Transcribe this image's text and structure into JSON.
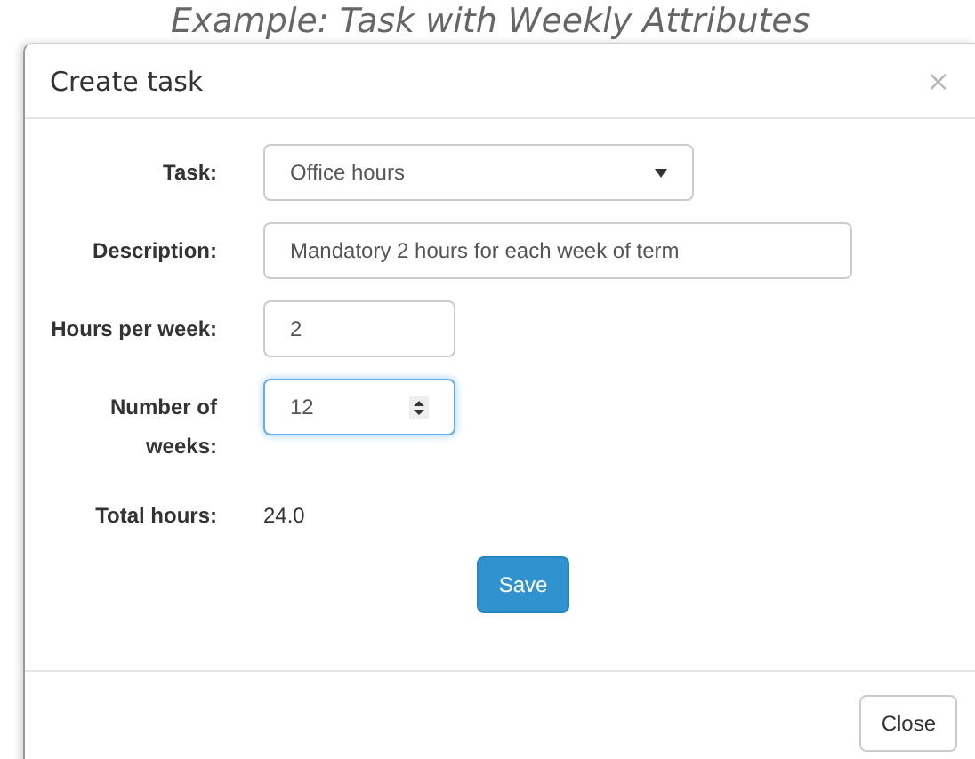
{
  "page_heading": "Example: Task with Weekly Attributes",
  "dialog": {
    "title": "Create task",
    "close_glyph": "×",
    "fields": [
      {
        "kind": "select",
        "label": "Task:",
        "value": "Office hours",
        "focused": false
      },
      {
        "kind": "text",
        "label": "Description:",
        "value": "Mandatory 2 hours for each week of term",
        "focused": false
      },
      {
        "kind": "text",
        "label": "Hours per week:",
        "value": "2",
        "focused": false
      },
      {
        "kind": "number",
        "label": "Number of weeks:",
        "value": "12",
        "focused": true
      },
      {
        "kind": "readout",
        "label": "Total hours:",
        "value": "24.0"
      }
    ],
    "primary_button": "Save",
    "footer_button": "Close"
  }
}
